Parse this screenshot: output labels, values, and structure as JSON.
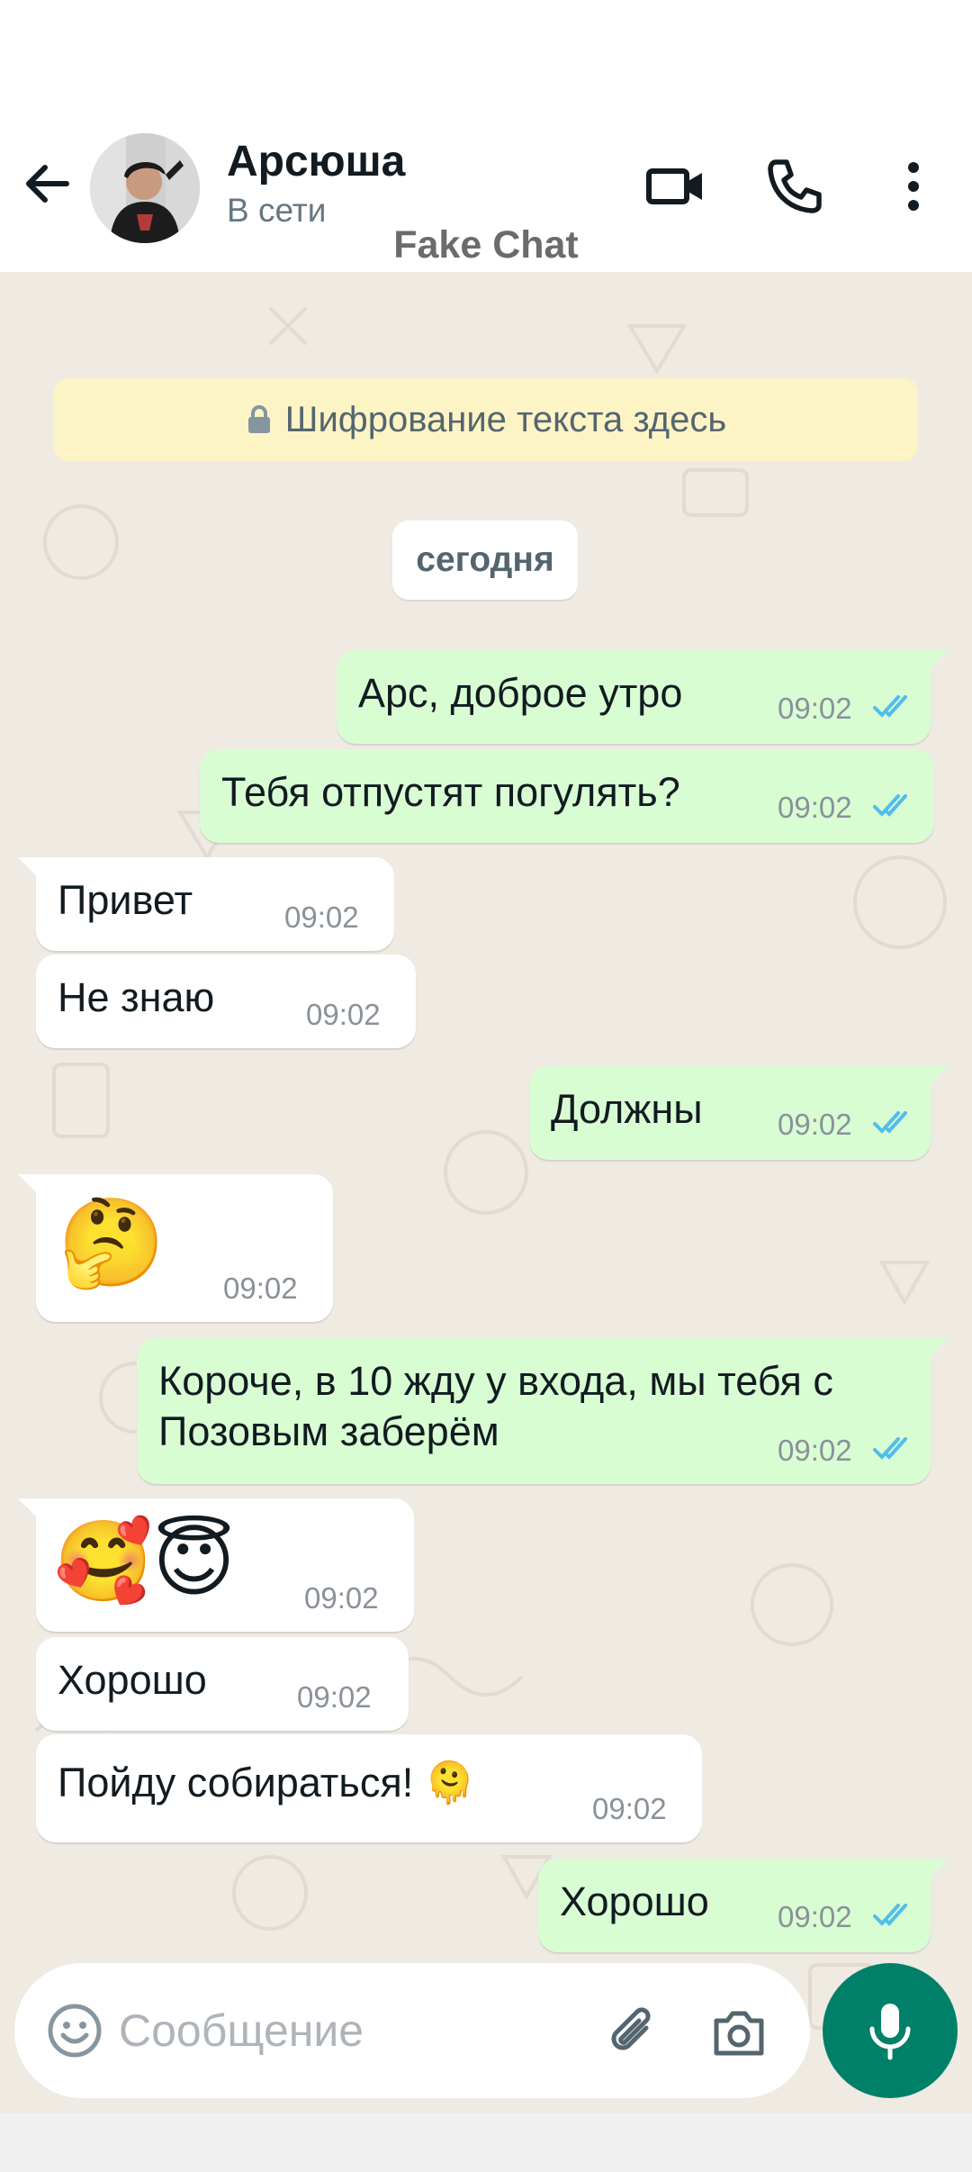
{
  "header": {
    "contact_name": "Арсюша",
    "status": "В сети",
    "watermark": "Fake Chat",
    "icons": [
      "back-arrow-icon",
      "video-call-icon",
      "voice-call-icon",
      "more-options-icon"
    ]
  },
  "chat": {
    "encryption_notice": "Шифрование текста здесь",
    "date_label": "сегодня",
    "messages": [
      {
        "direction": "out",
        "text": "Арс, доброе утро",
        "time": "09:02",
        "status": "read"
      },
      {
        "direction": "out",
        "text": "Тебя отпустят погулять?",
        "time": "09:02",
        "status": "read"
      },
      {
        "direction": "in",
        "text": "Привет",
        "time": "09:02"
      },
      {
        "direction": "in",
        "text": "Не знаю",
        "time": "09:02"
      },
      {
        "direction": "out",
        "text": "Должны",
        "time": "09:02",
        "status": "read"
      },
      {
        "direction": "in",
        "text": "🤔",
        "time": "09:02"
      },
      {
        "direction": "out",
        "text": "Короче, в 10 жду у входа, мы тебя с",
        "text_line2": "Позовым заберём",
        "time": "09:02",
        "status": "read"
      },
      {
        "direction": "in",
        "text": "🥰😇",
        "time": "09:02"
      },
      {
        "direction": "in",
        "text": "Хорошо",
        "time": "09:02"
      },
      {
        "direction": "in",
        "text": "Пойду собираться! 🫠",
        "time": "09:02"
      },
      {
        "direction": "out",
        "text": "Хорошо",
        "time": "09:02",
        "status": "read"
      }
    ]
  },
  "composer": {
    "placeholder": "Сообщение",
    "icons": [
      "emoji-icon",
      "attach-icon",
      "camera-icon",
      "mic-icon"
    ]
  },
  "colors": {
    "outgoing_bubble": "#d9fdd3",
    "incoming_bubble": "#ffffff",
    "chat_background": "#efeae2",
    "read_ticks": "#53bdeb",
    "accent": "#008069",
    "encryption_banner": "#fdf4c5"
  }
}
